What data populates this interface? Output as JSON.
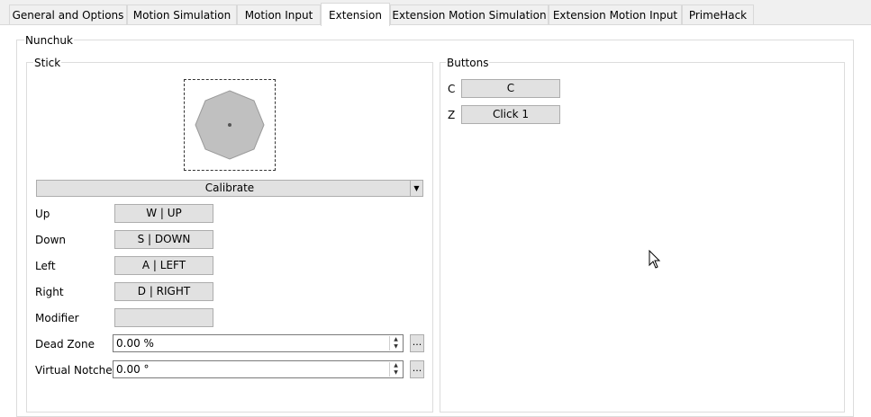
{
  "tabs": [
    {
      "label": "General and Options",
      "active": false
    },
    {
      "label": "Motion Simulation",
      "active": false
    },
    {
      "label": "Motion Input",
      "active": false
    },
    {
      "label": "Extension",
      "active": true
    },
    {
      "label": "Extension Motion Simulation",
      "active": false
    },
    {
      "label": "Extension Motion Input",
      "active": false
    },
    {
      "label": "PrimeHack",
      "active": false
    }
  ],
  "extension": {
    "group_title": "Nunchuk",
    "stick": {
      "title": "Stick",
      "calibrate_label": "Calibrate",
      "mappings": [
        {
          "label": "Up",
          "value": "W | UP"
        },
        {
          "label": "Down",
          "value": "S | DOWN"
        },
        {
          "label": "Left",
          "value": "A | LEFT"
        },
        {
          "label": "Right",
          "value": "D | RIGHT"
        },
        {
          "label": "Modifier",
          "value": ""
        }
      ],
      "dead_zone": {
        "label": "Dead Zone",
        "value": "0.00 %",
        "more": "..."
      },
      "virtual_notches": {
        "label": "Virtual Notches",
        "value": "0.00 °",
        "more": "..."
      }
    },
    "buttons": {
      "title": "Buttons",
      "items": [
        {
          "label": "C",
          "value": "C"
        },
        {
          "label": "Z",
          "value": "Click 1"
        }
      ]
    }
  },
  "icons": {
    "spin": "up-down-arrows-icon",
    "dropdown": "chevron-down-icon",
    "cursor": "mouse-pointer-icon"
  },
  "colors": {
    "button_bg": "#e1e1e1",
    "button_border": "#adadad",
    "octagon_fill": "#c0c0c0"
  }
}
